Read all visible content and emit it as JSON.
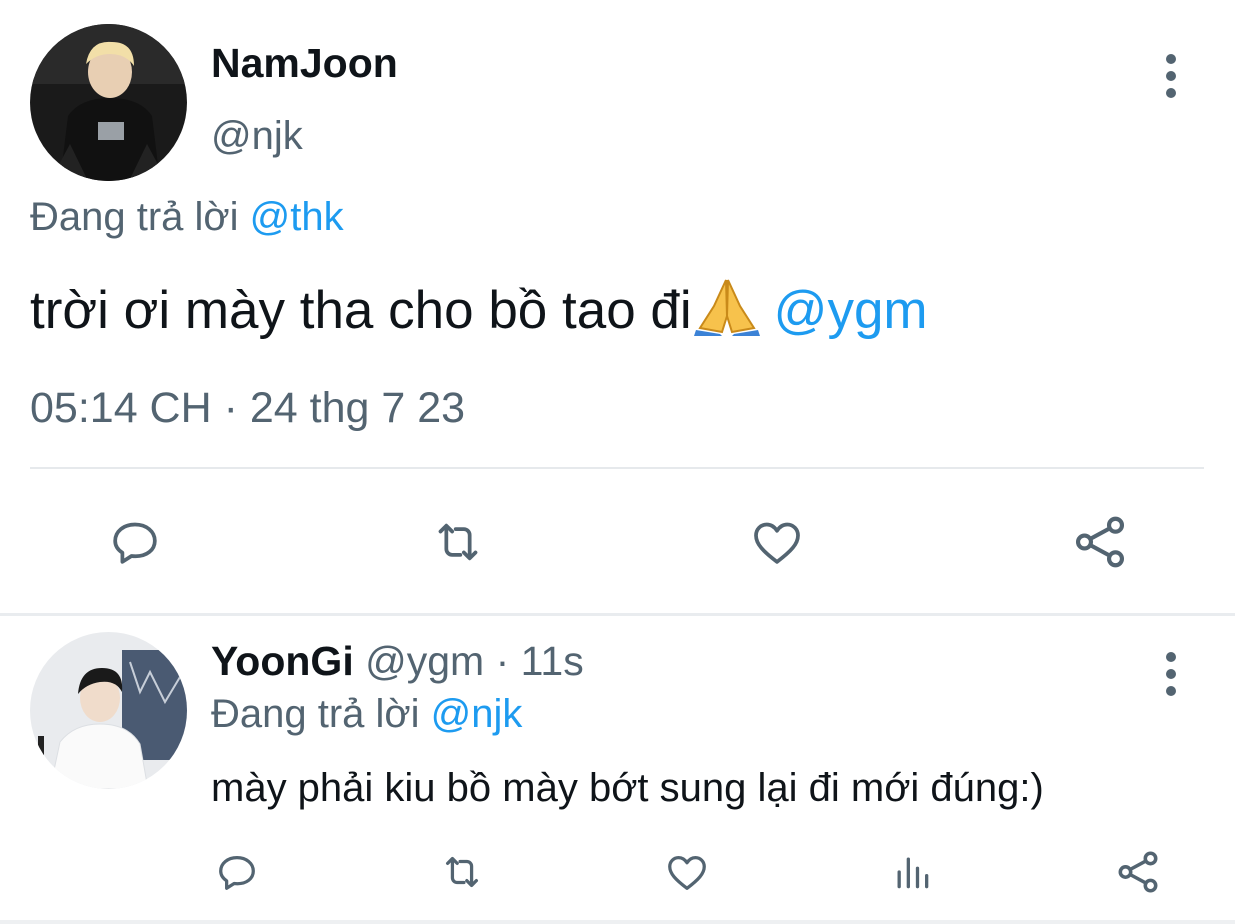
{
  "main_tweet": {
    "author": {
      "display_name": "NamJoon",
      "handle": "@njk",
      "avatar_icon": "user-avatar-photo"
    },
    "reply_context": {
      "prefix": "Đang trả lời ",
      "mention": "@thk"
    },
    "text": "trời ơi mày tha cho bồ tao đi",
    "emoji": "folded-hands-emoji",
    "mention": "@ygm",
    "timestamp": "05:14 CH · 24 thg 7 23",
    "actions": [
      "reply-icon",
      "retweet-icon",
      "like-icon",
      "share-icon"
    ],
    "more_icon": "more-vertical-icon"
  },
  "reply_tweet": {
    "author": {
      "display_name": "YoonGi",
      "meta": " @ygm · 11s",
      "avatar_icon": "user-avatar-photo"
    },
    "reply_context": {
      "prefix": "Đang trả lời ",
      "mention": "@njk"
    },
    "text": "mày phải kiu bồ mày bớt sung lại đi mới đúng:)",
    "actions": [
      "reply-icon",
      "retweet-icon",
      "like-icon",
      "analytics-icon",
      "share-icon"
    ],
    "more_icon": "more-vertical-icon"
  },
  "colors": {
    "text_primary": "#0f1419",
    "text_secondary": "#536471",
    "accent": "#1d9bf0",
    "divider": "#e6e9ec"
  }
}
